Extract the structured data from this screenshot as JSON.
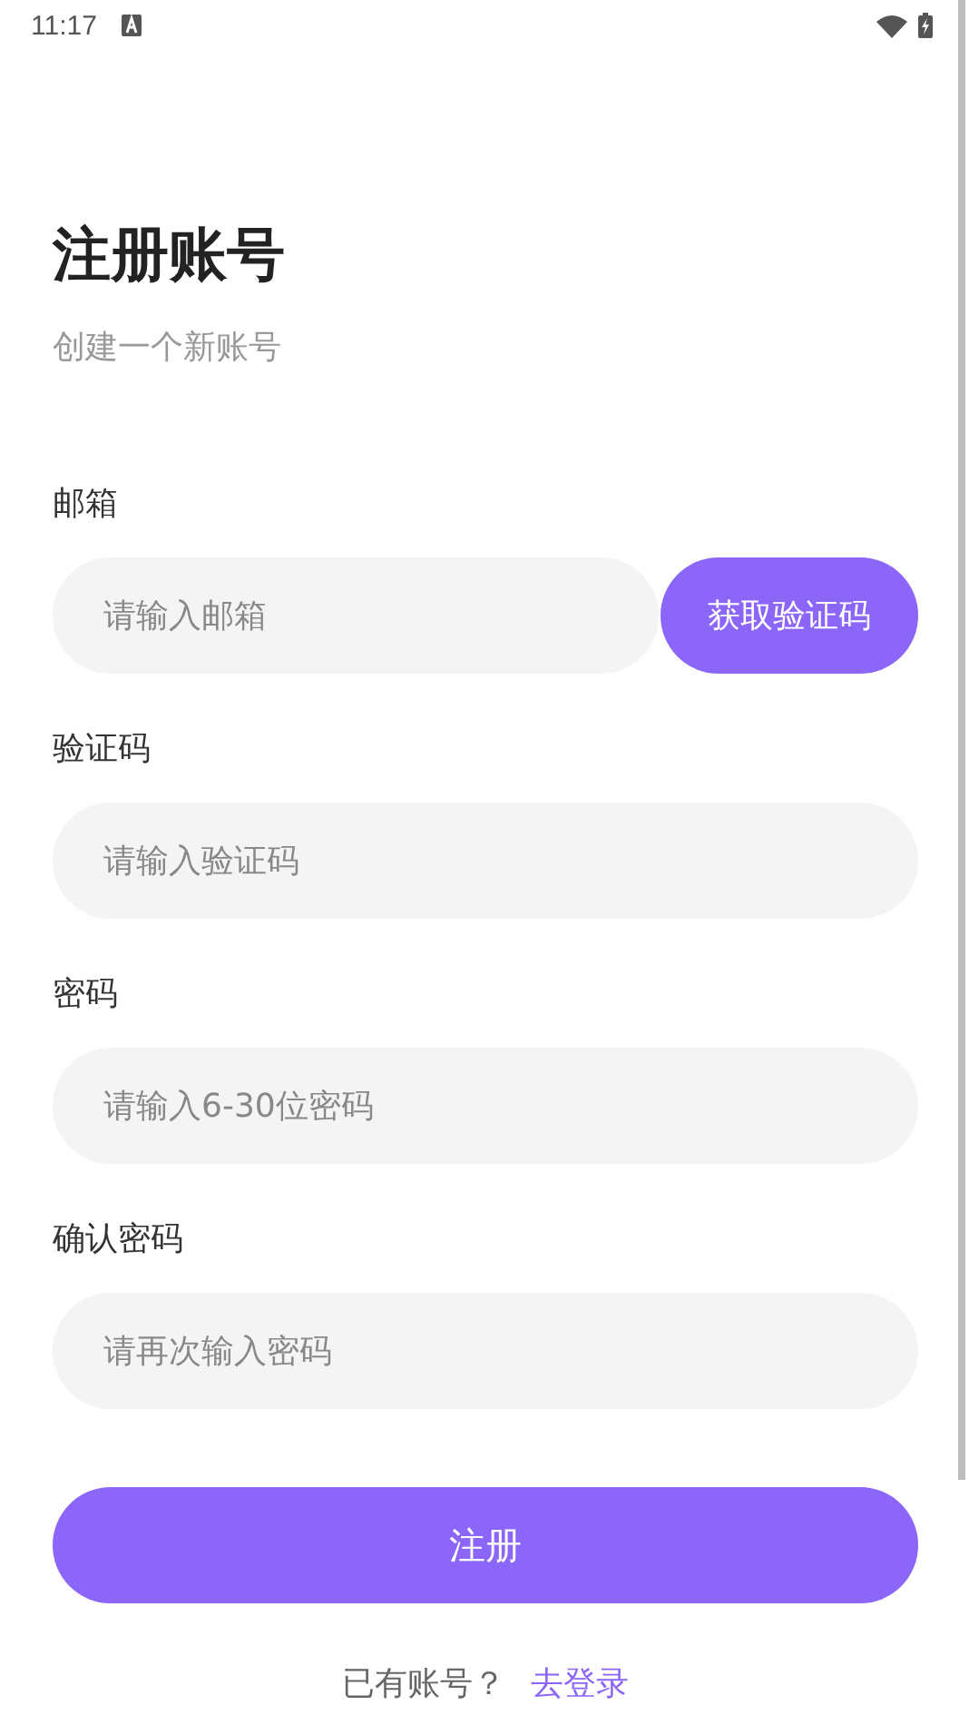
{
  "status_bar": {
    "time": "11:17"
  },
  "title": "注册账号",
  "subtitle": "创建一个新账号",
  "fields": [
    {
      "label": "邮箱",
      "placeholder": "请输入邮箱",
      "button": "获取验证码"
    },
    {
      "label": "验证码",
      "placeholder": "请输入验证码"
    },
    {
      "label": "密码",
      "placeholder": "请输入6-30位密码"
    },
    {
      "label": "确认密码",
      "placeholder": "请再次输入密码"
    }
  ],
  "submit": "注册",
  "footer": {
    "text": "已有账号？",
    "link": "去登录"
  }
}
